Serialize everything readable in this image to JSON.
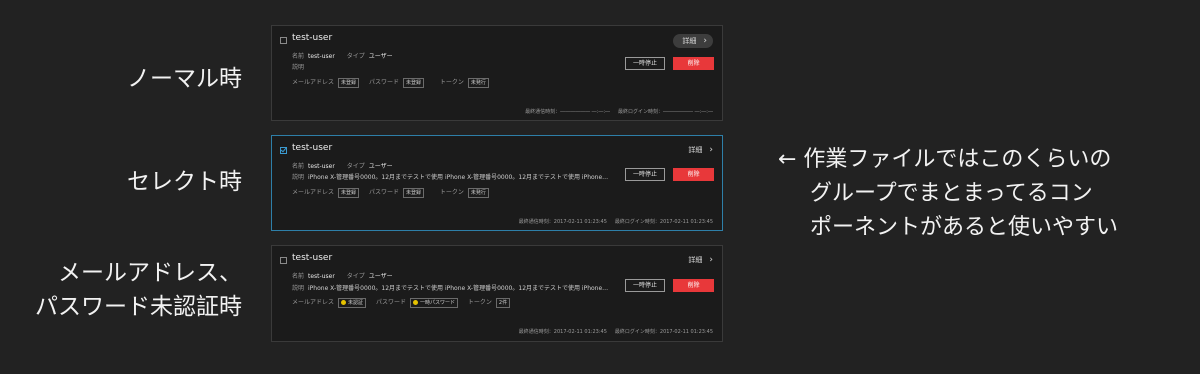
{
  "states": [
    {
      "label": "ノーマル時"
    },
    {
      "label": "セレクト時"
    },
    {
      "label_line1": "メールアドレス、",
      "label_line2": "パスワード未認証時"
    }
  ],
  "cards": [
    {
      "username": "test-user",
      "name_key": "名前",
      "name_value": "test-user",
      "type_key": "タイプ",
      "type_value": "ユーザー",
      "desc_key": "説明",
      "desc_value": "",
      "email_key": "メールアドレス",
      "email_status": "未登録",
      "password_key": "パスワード",
      "password_status": "未登録",
      "token_key": "トークン",
      "token_status": "未発行",
      "detail_label": "詳細",
      "stop_label": "一時停止",
      "delete_label": "削除",
      "last_comm": "最終通信時刻：―――――― ―:―:―",
      "last_login": "最終ログイン時刻：―――――― ―:―:―"
    },
    {
      "username": "test-user",
      "name_key": "名前",
      "name_value": "test-user",
      "type_key": "タイプ",
      "type_value": "ユーザー",
      "desc_key": "説明",
      "desc_value": "iPhone X-管理番号0000。12月までテストで使用 iPhone X-管理番号0000。12月までテストで使用 iPhone…",
      "email_key": "メールアドレス",
      "email_status": "未登録",
      "password_key": "パスワード",
      "password_status": "未登録",
      "token_key": "トークン",
      "token_status": "未発行",
      "detail_label": "詳細",
      "stop_label": "一時停止",
      "delete_label": "削除",
      "last_comm": "最終通信時刻：2017-02-11 01:23:45",
      "last_login": "最終ログイン時刻：2017-02-11 01:23:45"
    },
    {
      "username": "test-user",
      "name_key": "名前",
      "name_value": "test-user",
      "type_key": "タイプ",
      "type_value": "ユーザー",
      "desc_key": "説明",
      "desc_value": "iPhone X-管理番号0000。12月までテストで使用 iPhone X-管理番号0000。12月までテストで使用 iPhone…",
      "email_key": "メールアドレス",
      "email_status": "未認証",
      "password_key": "パスワード",
      "password_status": "一時パスワード",
      "token_key": "トークン",
      "token_status": "2件",
      "detail_label": "詳細",
      "stop_label": "一時停止",
      "delete_label": "削除",
      "last_comm": "最終通信時刻：2017-02-11 01:23:45",
      "last_login": "最終ログイン時刻：2017-02-11 01:23:45"
    }
  ],
  "note": {
    "line1": "← 作業ファイルではこのくらいの",
    "line2": "グループでまとまってるコン",
    "line3": "ポーネントがあると使いやすい"
  },
  "colors": {
    "background": "#222222",
    "card": "#1b1b1b",
    "selected_border": "#2e7fa8",
    "delete": "#e8383a",
    "warning_dot": "#e6c200"
  }
}
